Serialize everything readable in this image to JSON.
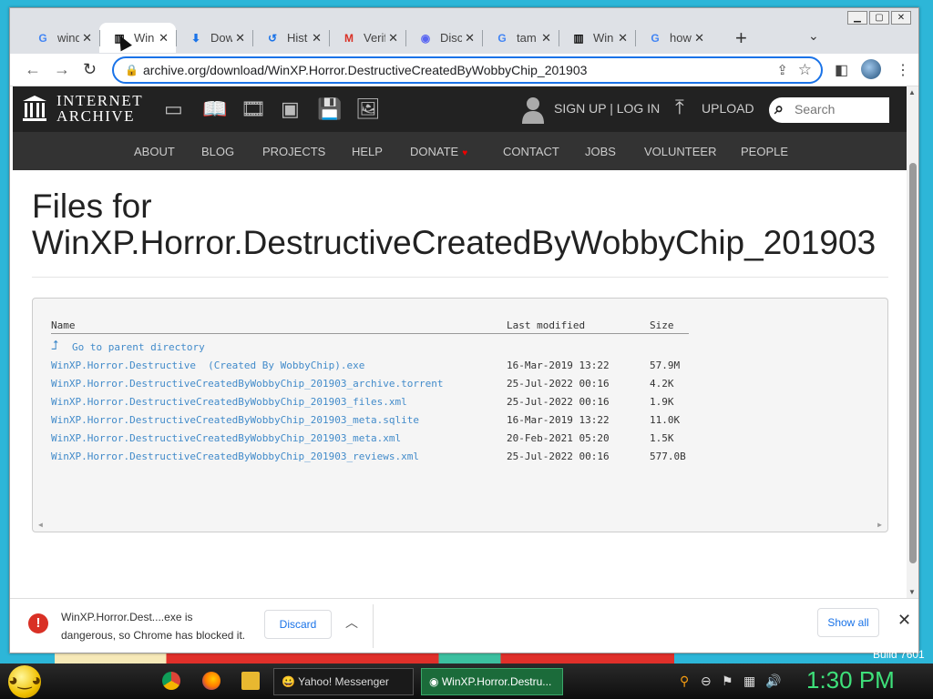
{
  "browser": {
    "tabs": [
      {
        "icon": "google-icon",
        "title": "wind"
      },
      {
        "icon": "internet-archive-icon",
        "title": "Win",
        "active": true
      },
      {
        "icon": "download-icon",
        "title": "Dow"
      },
      {
        "icon": "history-icon",
        "title": "Hist"
      },
      {
        "icon": "gmail-icon",
        "title": "Verif"
      },
      {
        "icon": "discord-icon",
        "title": "Disc"
      },
      {
        "icon": "google-icon",
        "title": "tam"
      },
      {
        "icon": "internet-archive-icon",
        "title": "Win"
      },
      {
        "icon": "google-icon",
        "title": "how"
      }
    ],
    "new_tab": "+",
    "url": "archive.org/download/WinXP.Horror.DestructiveCreatedByWobbyChip_201903"
  },
  "ia": {
    "logo_line1": "INTERNET",
    "logo_line2": "ARCHIVE",
    "signup_login": "SIGN UP | LOG IN",
    "upload": "UPLOAD",
    "search_placeholder": "Search",
    "nav": [
      "ABOUT",
      "BLOG",
      "PROJECTS",
      "HELP",
      "DONATE",
      "CONTACT",
      "JOBS",
      "VOLUNTEER",
      "PEOPLE"
    ]
  },
  "page": {
    "title_line1": "Files for",
    "title_line2": "WinXP.Horror.DestructiveCreatedByWobbyChip_201903"
  },
  "listing": {
    "headers": {
      "name": "Name",
      "modified": "Last modified",
      "size": "Size"
    },
    "parent": "Go to parent directory",
    "rows": [
      {
        "name": "WinXP.Horror.Destructive  (Created By WobbyChip).exe",
        "modified": "16-Mar-2019 13:22",
        "size": "57.9M"
      },
      {
        "name": "WinXP.Horror.DestructiveCreatedByWobbyChip_201903_archive.torrent",
        "modified": "25-Jul-2022 00:16",
        "size": "4.2K"
      },
      {
        "name": "WinXP.Horror.DestructiveCreatedByWobbyChip_201903_files.xml",
        "modified": "25-Jul-2022 00:16",
        "size": "1.9K"
      },
      {
        "name": "WinXP.Horror.DestructiveCreatedByWobbyChip_201903_meta.sqlite",
        "modified": "16-Mar-2019 13:22",
        "size": "11.0K"
      },
      {
        "name": "WinXP.Horror.DestructiveCreatedByWobbyChip_201903_meta.xml",
        "modified": "20-Feb-2021 05:20",
        "size": "1.5K"
      },
      {
        "name": "WinXP.Horror.DestructiveCreatedByWobbyChip_201903_reviews.xml",
        "modified": "25-Jul-2022 00:16",
        "size": "577.0B"
      }
    ]
  },
  "download_bar": {
    "message_line1": "WinXP.Horror.Dest....exe is",
    "message_line2": "dangerous, so Chrome has blocked it.",
    "discard": "Discard",
    "show_all": "Show all"
  },
  "desktop": {
    "build": "Build 7601"
  },
  "taskbar": {
    "items": [
      "Yahoo! Messenger",
      "WinXP.Horror.Destru..."
    ],
    "clock": "1:30 PM"
  }
}
